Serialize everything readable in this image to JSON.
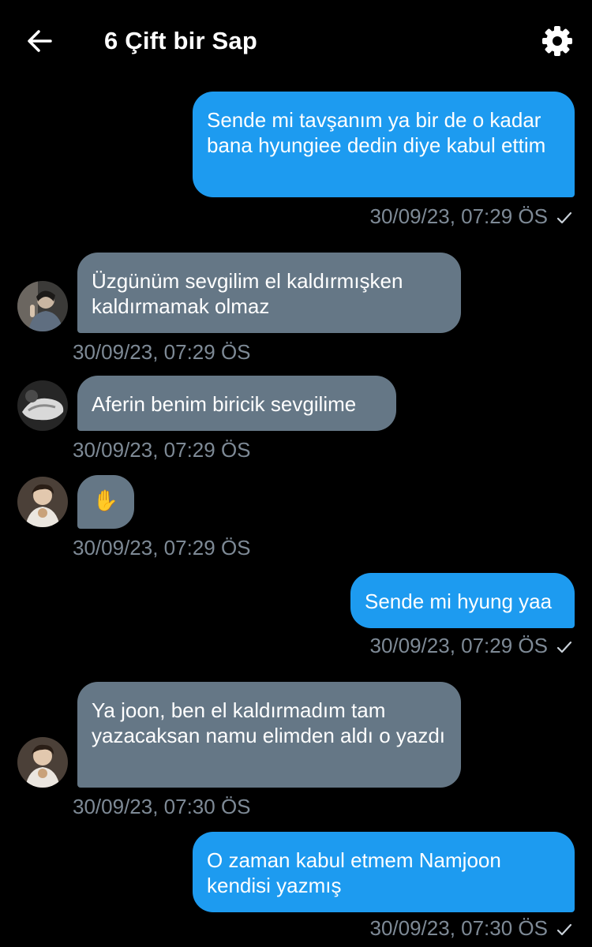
{
  "header": {
    "title": "6 Çift bir Sap"
  },
  "messages": [
    {
      "side": "sent",
      "text": "Sende mi tavşanım ya bir de o kadar bana hyungiee dedin diye kabul ettim",
      "time": "30/09/23, 07:29 ÖS"
    },
    {
      "side": "recv",
      "text": "Üzgünüm sevgilim el kaldırmışken kaldırmamak olmaz",
      "time": "30/09/23, 07:29 ÖS"
    },
    {
      "side": "recv",
      "text": "Aferin benim biricik sevgilime",
      "time": "30/09/23, 07:29 ÖS"
    },
    {
      "side": "recv",
      "text": "✋",
      "time": "30/09/23, 07:29 ÖS"
    },
    {
      "side": "sent",
      "text": "Sende mi hyung yaa",
      "time": "30/09/23, 07:29 ÖS"
    },
    {
      "side": "recv",
      "text": "Ya joon, ben el kaldırmadım tam yazacaksan namu elimden aldı o yazdı",
      "time": "30/09/23, 07:30 ÖS"
    },
    {
      "side": "sent",
      "text": "O zaman kabul etmem Namjoon kendisi yazmış",
      "time": "30/09/23, 07:30 ÖS"
    }
  ],
  "colors": {
    "background": "#000000",
    "sent_bubble": "#1d9bf0",
    "received_bubble": "#657786",
    "timestamp": "#7e8a96"
  }
}
